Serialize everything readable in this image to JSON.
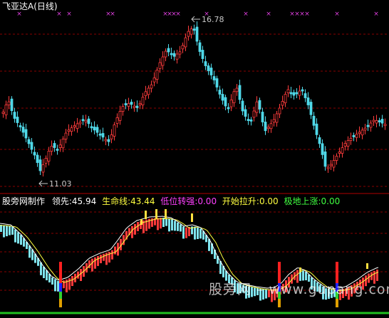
{
  "chart_title": {
    "name": "飞亚达A",
    "period": "(日线)"
  },
  "price_chart": {
    "type": "candlestick",
    "high_label": "16.78",
    "low_label": "11.03",
    "markers": "× × × × × × × × × × × × × ×",
    "colors": {
      "up": "#ff3c3c",
      "down": "#4fd8e8",
      "marker": "#e040e0",
      "label": "#c8c8c8",
      "grid": "#8a0000"
    }
  },
  "indicator": {
    "name": "股旁网制作",
    "fields": [
      {
        "label": "领先:",
        "value": "45.94",
        "color": "#ffffff"
      },
      {
        "label": "生命线:",
        "value": "43.44",
        "color": "#ffff40"
      },
      {
        "label": "低位转强:",
        "value": "0.00",
        "color": "#ff40ff"
      },
      {
        "label": "开始拉升:",
        "value": "0.00",
        "color": "#ffff40"
      },
      {
        "label": "极地上涨:",
        "value": "0.00",
        "color": "#40ff40"
      }
    ],
    "colors": {
      "rising_bar": "#ff3a3a",
      "falling_bar": "#7fe4ee",
      "lead_line": "#ffffff",
      "life_line": "#ffff40",
      "signal_bar": "#ffe040"
    }
  },
  "watermark": "股旁网 – www.gupang.com"
}
